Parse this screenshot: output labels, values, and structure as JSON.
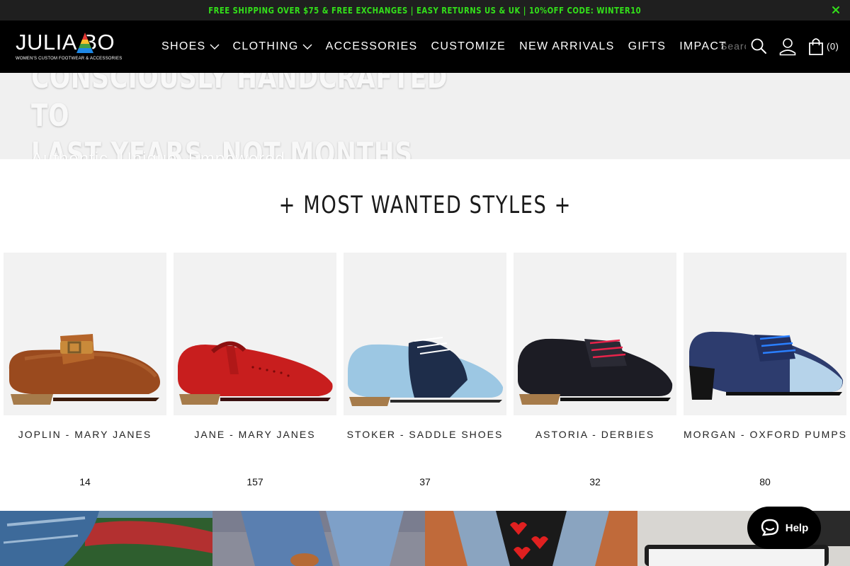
{
  "announcement": {
    "text": "FREE SHIPPING OVER $75 & FREE EXCHANGES | EASY RETURNS US & UK | 10%OFF CODE: WINTER10",
    "color": "#33e01a"
  },
  "header": {
    "logo_text": "JULIA BO",
    "logo_tagline": "WOMEN'S CUSTOM FOOTWEAR & ACCESSORIES",
    "nav": [
      {
        "label": "SHOES",
        "dropdown": true
      },
      {
        "label": "CLOTHING",
        "dropdown": true
      },
      {
        "label": "ACCESSORIES",
        "dropdown": false
      },
      {
        "label": "CUSTOMIZE",
        "dropdown": false
      },
      {
        "label": "NEW ARRIVALS",
        "dropdown": false
      },
      {
        "label": "GIFTS",
        "dropdown": false
      },
      {
        "label": "IMPACT",
        "dropdown": false
      }
    ],
    "search_placeholder": "Search",
    "cart_count": "(0)"
  },
  "hero": {
    "title_line1": "CONSCIOUSLY HANDCRAFTED TO",
    "title_line2": "LAST YEARS, NOT MONTHS",
    "subtitle": "Authentic. Unique. Empowered."
  },
  "section": {
    "title": "+ MOST WANTED STYLES +"
  },
  "products": [
    {
      "name": "JOPLIN - MARY JANES",
      "count": "14",
      "icon": "brown-mary-jane-shoe"
    },
    {
      "name": "JANE - MARY JANES",
      "count": "157",
      "icon": "red-t-strap-shoe"
    },
    {
      "name": "STOKER - SADDLE SHOES",
      "count": "37",
      "icon": "blue-saddle-shoe"
    },
    {
      "name": "ASTORIA - DERBIES",
      "count": "32",
      "icon": "black-derby-shoe"
    },
    {
      "name": "MORGAN - OXFORD PUMPS",
      "count": "80",
      "icon": "navy-oxford-pump"
    }
  ],
  "help": {
    "label": "Help"
  }
}
